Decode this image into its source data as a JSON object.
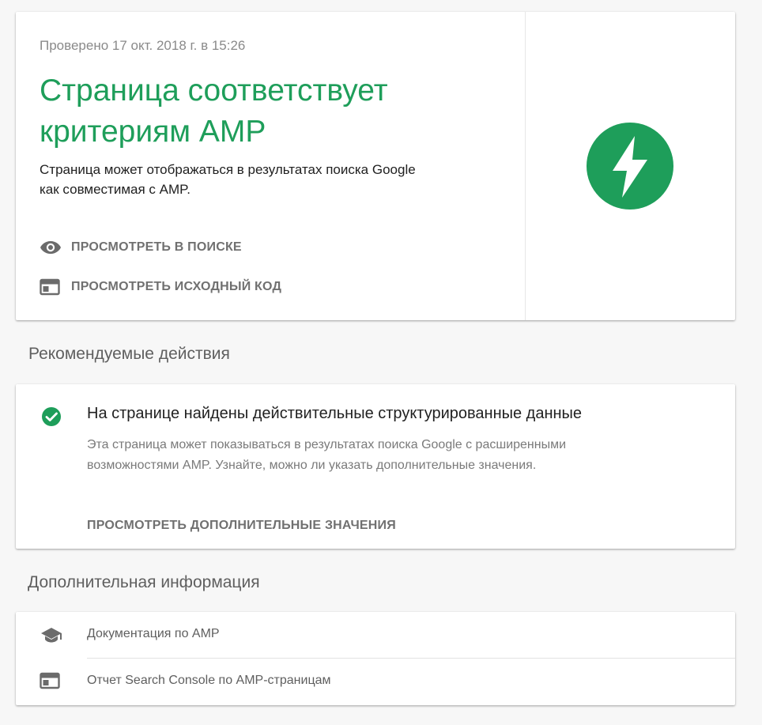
{
  "status": {
    "checked_at": "Проверено 17 окт. 2018 г. в 15:26",
    "verdict_line1": "Страница соответствует",
    "verdict_line2": "критериям AMP",
    "description_line1": "Страница может отображаться в результатах поиска Google",
    "description_line2": "как совместимая с AMP.",
    "actions": [
      {
        "label": "ПРОСМОТРЕТЬ В ПОИСКЕ",
        "icon": "eye-icon"
      },
      {
        "label": "ПРОСМОТРЕТЬ ИСХОДНЫЙ КОД",
        "icon": "web-page-icon"
      }
    ],
    "badge_icon": "amp-lightning-icon",
    "accent_color": "#1e9e5a"
  },
  "recommended": {
    "section_title": "Рекомендуемые действия",
    "item": {
      "icon": "check-circle-icon",
      "title": "На странице найдены действительные структурированные данные",
      "description_line1": "Эта страница может показываться в результатах поиска Google с расширенными",
      "description_line2": "возможностями AMP. Узнайте, можно ли указать дополнительные значения.",
      "link_label": "ПРОСМОТРЕТЬ ДОПОЛНИТЕЛЬНЫЕ ЗНАЧЕНИЯ"
    }
  },
  "more_info": {
    "section_title": "Дополнительная информация",
    "items": [
      {
        "label": "Документация по AMP",
        "icon": "school-cap-icon"
      },
      {
        "label": "Отчет Search Console по AMP-страницам",
        "icon": "web-page-icon"
      }
    ]
  }
}
